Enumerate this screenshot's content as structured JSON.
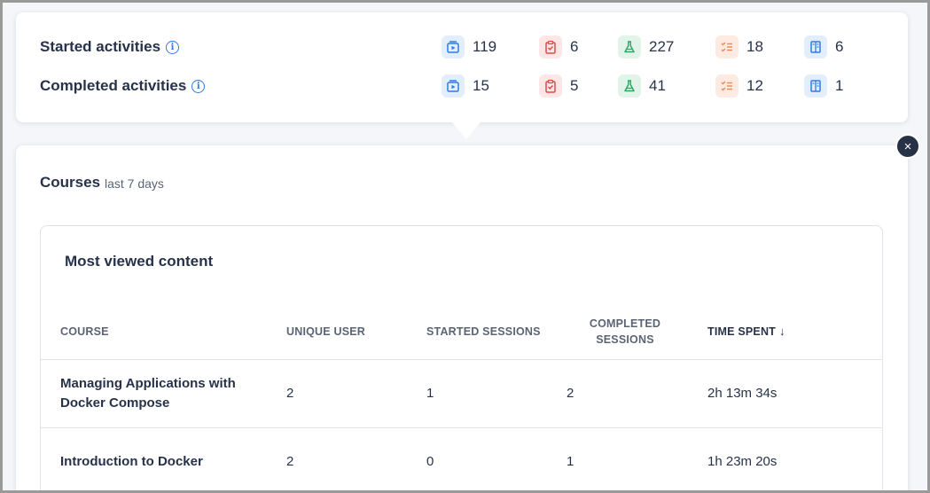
{
  "activity": {
    "started_label": "Started activities",
    "completed_label": "Completed activities",
    "started": {
      "videos": "119",
      "assessments": "6",
      "labs": "227",
      "checklists": "18",
      "guides": "6"
    },
    "completed": {
      "videos": "15",
      "assessments": "5",
      "labs": "41",
      "checklists": "12",
      "guides": "1"
    }
  },
  "courses": {
    "title": "Courses",
    "subtitle": "last 7 days",
    "close_icon": "×"
  },
  "table": {
    "title": "Most viewed content",
    "headers": {
      "course": "COURSE",
      "unique_user": "UNIQUE USER",
      "started_sessions": "STARTED SESSIONS",
      "completed_sessions_1": "COMPLETED",
      "completed_sessions_2": "SESSIONS",
      "time_spent": "TIME SPENT",
      "sort_icon": "↓"
    },
    "rows": [
      {
        "course": "Managing Applications with Docker Compose",
        "unique_user": "2",
        "started": "1",
        "completed": "2",
        "time": "2h 13m 34s"
      },
      {
        "course": "Introduction to Docker",
        "unique_user": "2",
        "started": "0",
        "completed": "1",
        "time": "1h 23m 20s"
      }
    ]
  },
  "colors": {
    "video": "#2f7be3",
    "assessment": "#e04848",
    "lab": "#2fa866",
    "checklist": "#f0865c",
    "guide": "#2f7be3"
  }
}
